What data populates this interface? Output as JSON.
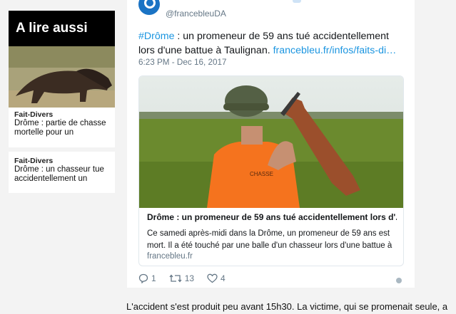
{
  "sidebar": {
    "heading": "A lire aussi",
    "items": [
      {
        "category": "Fait-Divers",
        "title": "Drôme : partie de chasse mortelle pour un"
      },
      {
        "category": "Fait-Divers",
        "title": "Drôme : un chasseur tue accidentellement un"
      }
    ]
  },
  "tweet": {
    "handle": "@francebleuDA",
    "hashtag": "#Drôme",
    "text": " : un promeneur de 59 ans tué accidentellement lors d'une battue à Taulignan. ",
    "link": "francebleu.fr/infos/faits-di…",
    "date": "6:23 PM - Dec 16, 2017",
    "card": {
      "title": "Drôme : un promeneur de 59 ans tué accidentellement lors d'...",
      "description": "Ce samedi après-midi dans la Drôme, un promeneur de 59 ans est mort. Il a été touché par une balle d'un chasseur lors d'une battue à",
      "domain": "francebleu.fr"
    },
    "actions": {
      "replies": "1",
      "retweets": "13",
      "likes": "4"
    }
  },
  "article": {
    "text": "L'accident s'est produit peu avant 15h30. La victime, qui se promenait seule, a"
  },
  "colors": {
    "link": "#1b95e0",
    "brand": "#1a73c4",
    "vest": "#f5731e"
  }
}
